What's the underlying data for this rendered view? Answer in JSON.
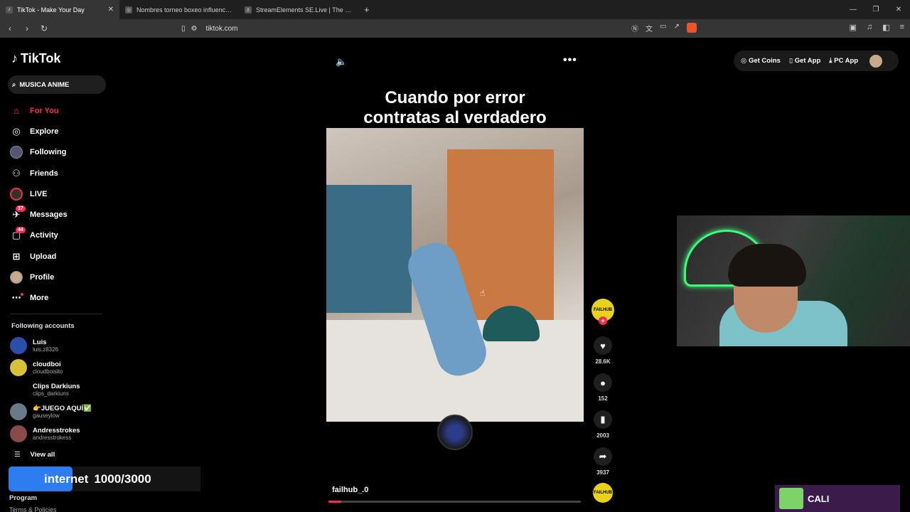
{
  "browser": {
    "tabs": [
      {
        "title": "TikTok - Make Your Day",
        "active": true
      },
      {
        "title": "Nombres torneo boxeo influencers",
        "active": false
      },
      {
        "title": "StreamElements SE.Live | The Ultimat",
        "active": false
      }
    ],
    "url": "tiktok.com"
  },
  "sidebar": {
    "logo": "TikTok",
    "search_value": "MUSICA ANIME",
    "nav": [
      {
        "label": "For You",
        "icon": "home-icon",
        "active": true
      },
      {
        "label": "Explore",
        "icon": "compass-icon"
      },
      {
        "label": "Following",
        "icon": "avatar-icon"
      },
      {
        "label": "Friends",
        "icon": "friends-icon"
      },
      {
        "label": "LIVE",
        "icon": "live-icon"
      },
      {
        "label": "Messages",
        "icon": "messages-icon",
        "badge": "37"
      },
      {
        "label": "Activity",
        "icon": "activity-icon",
        "badge": "44"
      },
      {
        "label": "Upload",
        "icon": "upload-icon"
      },
      {
        "label": "Profile",
        "icon": "profile-icon"
      },
      {
        "label": "More",
        "icon": "more-icon"
      }
    ],
    "following_title": "Following accounts",
    "accounts": [
      {
        "name": "Luis",
        "username": "luis.z8326"
      },
      {
        "name": "cloudboi",
        "username": "cloudboisito"
      },
      {
        "name": "Clips Darkiuns",
        "username": "clips_darkiuns"
      },
      {
        "name": "👉JUEGO AQUÍ✅",
        "username": "gauseylow"
      },
      {
        "name": "Andresstrokes",
        "username": "andresstrokess"
      }
    ],
    "view_all": "View all",
    "program": "Program",
    "terms": "Terms & Policies"
  },
  "overlay": {
    "word": "internet",
    "count": "1000/3000",
    "progress": 0.333
  },
  "video": {
    "caption_line1": "Cuando por error",
    "caption_line2": "contratas al verdadero",
    "author": "failhub_.0",
    "progress": 0.05,
    "creator_avatar_text": "FAILHUB",
    "likes": "28.6K",
    "comments": "152",
    "saves": "2003",
    "shares": "3937"
  },
  "topright": {
    "coins": "Get Coins",
    "app": "Get App",
    "pc": "PC App"
  },
  "stream": {
    "name": "CALI"
  }
}
